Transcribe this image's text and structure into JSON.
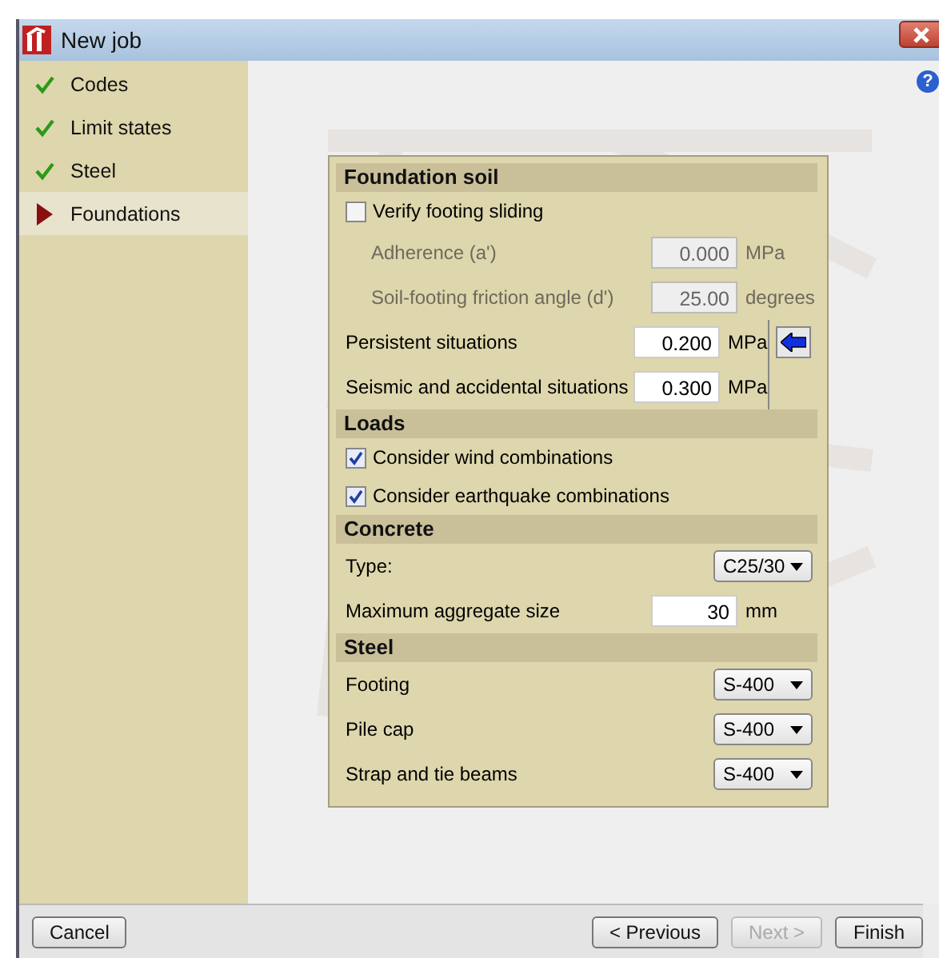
{
  "window": {
    "title": "New job",
    "help": "?"
  },
  "sidebar": {
    "items": [
      {
        "label": "Codes",
        "kind": "done",
        "selected": false
      },
      {
        "label": "Limit states",
        "kind": "done",
        "selected": false
      },
      {
        "label": "Steel",
        "kind": "done",
        "selected": false
      },
      {
        "label": "Foundations",
        "kind": "current",
        "selected": true
      }
    ]
  },
  "sections": [
    {
      "title": "Foundation soil",
      "rows": [
        {
          "kind": "checkbox",
          "label": "Verify footing sliding",
          "checked": false
        },
        {
          "kind": "number",
          "label": "Adherence (a')",
          "value": "0.000",
          "unit": "MPa",
          "disabled": true
        },
        {
          "kind": "number",
          "label": "Soil-footing friction angle (d')",
          "value": "25.00",
          "unit": "degrees",
          "disabled": true
        },
        {
          "kind": "group",
          "rows": [
            {
              "kind": "number",
              "label": "Persistent situations",
              "value": "0.200",
              "unit": "MPa",
              "disabled": false
            },
            {
              "kind": "number",
              "label": "Seismic and accidental situations",
              "value": "0.300",
              "unit": "MPa",
              "disabled": false
            }
          ]
        }
      ]
    },
    {
      "title": "Loads",
      "rows": [
        {
          "kind": "checkbox",
          "label": "Consider wind combinations",
          "checked": true
        },
        {
          "kind": "checkbox",
          "label": "Consider earthquake combinations",
          "checked": true
        }
      ]
    },
    {
      "title": "Concrete",
      "rows": [
        {
          "kind": "select",
          "label": "Type:",
          "value": "C25/30"
        },
        {
          "kind": "number",
          "label": "Maximum aggregate size",
          "value": "30",
          "unit": "mm",
          "disabled": false
        }
      ]
    },
    {
      "title": "Steel",
      "rows": [
        {
          "kind": "select",
          "label": "Footing",
          "value": "S-400"
        },
        {
          "kind": "select",
          "label": "Pile cap",
          "value": "S-400"
        },
        {
          "kind": "select",
          "label": "Strap and tie beams",
          "value": "S-400"
        }
      ]
    }
  ],
  "buttons": [
    {
      "label": "Cancel",
      "kind": "cancel",
      "disabled": false
    },
    {
      "label": "< Previous",
      "kind": "nav",
      "disabled": false
    },
    {
      "label": "Next >",
      "kind": "nav",
      "disabled": true
    },
    {
      "label": "Finish",
      "kind": "nav",
      "disabled": false
    }
  ]
}
